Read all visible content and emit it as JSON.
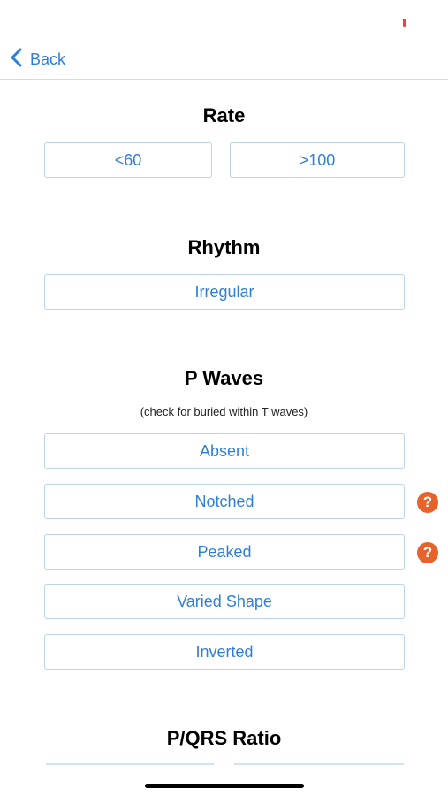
{
  "nav": {
    "back_label": "Back"
  },
  "sections": {
    "rate": {
      "title": "Rate",
      "options": [
        "<60",
        ">100"
      ]
    },
    "rhythm": {
      "title": "Rhythm",
      "options": [
        "Irregular"
      ]
    },
    "p_waves": {
      "title": "P Waves",
      "hint": "(check for buried within T waves)",
      "options": [
        "Absent",
        "Notched",
        "Peaked",
        "Varied Shape",
        "Inverted"
      ],
      "help_icon": "?"
    },
    "pqrs_ratio": {
      "title": "P/QRS Ratio"
    }
  },
  "colors": {
    "accent": "#2f7fd8",
    "button_border": "#bcd3ea",
    "help_icon": "#e8622c",
    "divider": "#d9d9d9"
  },
  "icons": {
    "back": "chevron-left-icon",
    "help": "question-circle-icon"
  }
}
